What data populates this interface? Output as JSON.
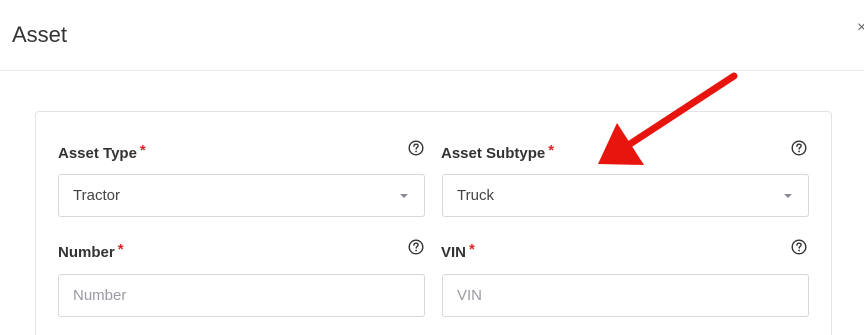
{
  "modal": {
    "title": "Asset",
    "close_glyph": "×"
  },
  "form": {
    "required_marker": "*",
    "asset_type": {
      "label": "Asset Type",
      "value": "Tractor"
    },
    "asset_subtype": {
      "label": "Asset Subtype",
      "value": "Truck"
    },
    "number": {
      "label": "Number",
      "placeholder": "Number"
    },
    "vin": {
      "label": "VIN",
      "placeholder": "VIN"
    }
  },
  "icons": {
    "help": "question-circle-icon",
    "dropdown": "caret-down-icon",
    "annotation": "red-arrow-icon"
  },
  "colors": {
    "required": "#e02424",
    "annotation_arrow": "#e8150f",
    "border": "#d7d7dc"
  }
}
